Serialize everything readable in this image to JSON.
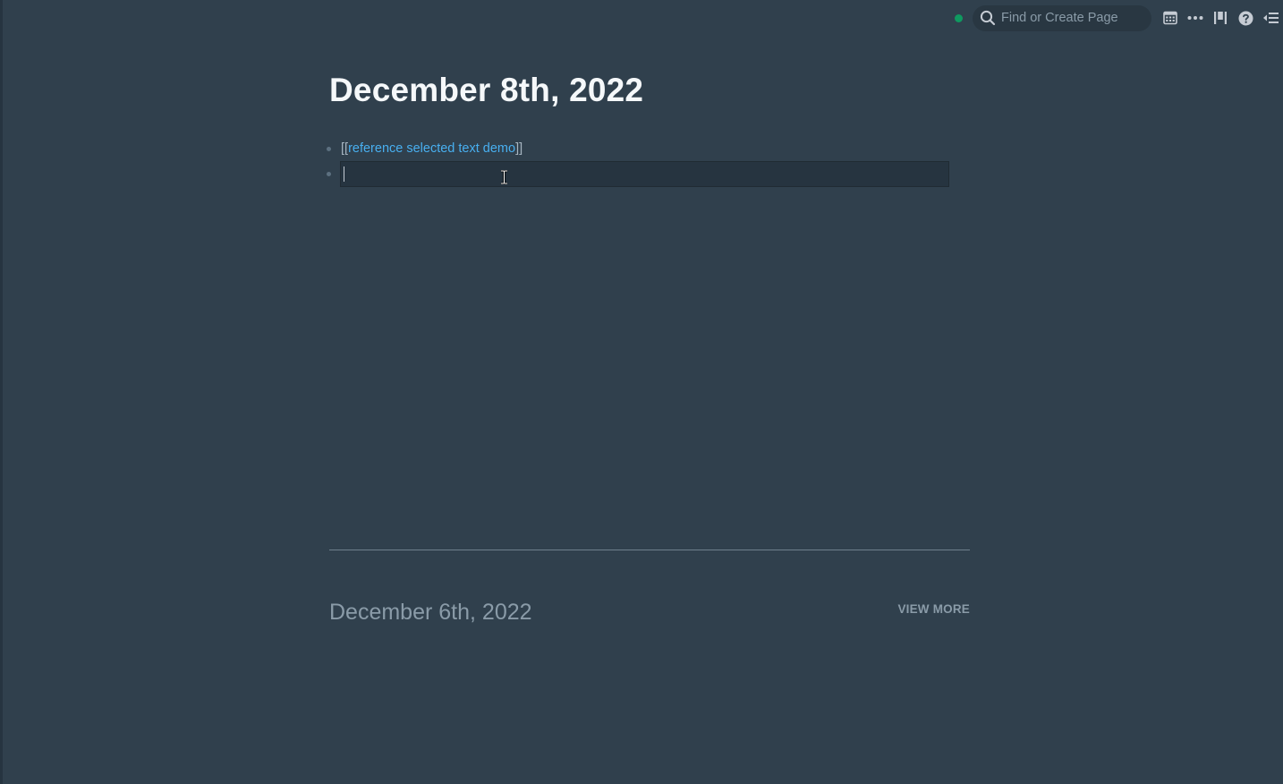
{
  "topbar": {
    "sync_status_color": "#0f9960",
    "search_placeholder": "Find or Create Page",
    "icons": [
      "calendar-icon",
      "more-icon",
      "column-layout-icon",
      "help-icon",
      "right-sidebar-icon"
    ]
  },
  "page": {
    "title": "December 8th, 2022",
    "blocks": [
      {
        "open_bracket": "[[",
        "link_text": "reference selected text demo",
        "close_bracket": "]]"
      },
      {
        "editing": true,
        "text": ""
      }
    ]
  },
  "older_notes": {
    "title": "December 6th, 2022",
    "view_more_label": "VIEW MORE"
  },
  "colors": {
    "background": "#30404d",
    "link": "#48aff0",
    "muted": "#8a9ba8"
  }
}
